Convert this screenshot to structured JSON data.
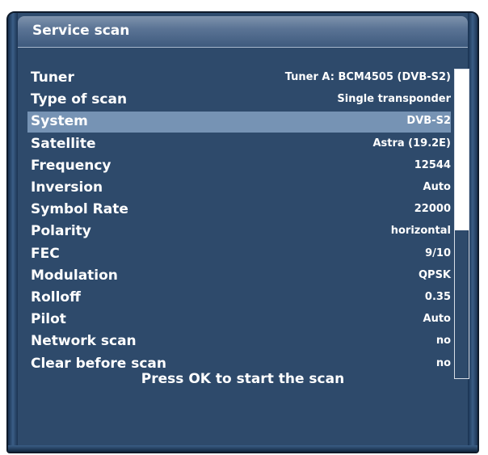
{
  "window": {
    "title": "Service scan"
  },
  "settings": [
    {
      "label": "Tuner",
      "value": "Tuner A: BCM4505 (DVB-S2)"
    },
    {
      "label": "Type of scan",
      "value": "Single transponder"
    },
    {
      "label": "System",
      "value": "DVB-S2"
    },
    {
      "label": "Satellite",
      "value": "Astra (19.2E)"
    },
    {
      "label": "Frequency",
      "value": "12544"
    },
    {
      "label": "Inversion",
      "value": "Auto"
    },
    {
      "label": "Symbol Rate",
      "value": "22000"
    },
    {
      "label": "Polarity",
      "value": "horizontal"
    },
    {
      "label": "FEC",
      "value": "9/10"
    },
    {
      "label": "Modulation",
      "value": "QPSK"
    },
    {
      "label": "Rolloff",
      "value": "0.35"
    },
    {
      "label": "Pilot",
      "value": "Auto"
    },
    {
      "label": "Network scan",
      "value": "no"
    },
    {
      "label": "Clear before scan",
      "value": "no"
    }
  ],
  "selected_index": 2,
  "scroll_fraction": 0.52,
  "hint": "Press OK to start the scan",
  "colors": {
    "background": "#2e4a6b",
    "selection": "#7693b4",
    "text": "#ffffff"
  }
}
